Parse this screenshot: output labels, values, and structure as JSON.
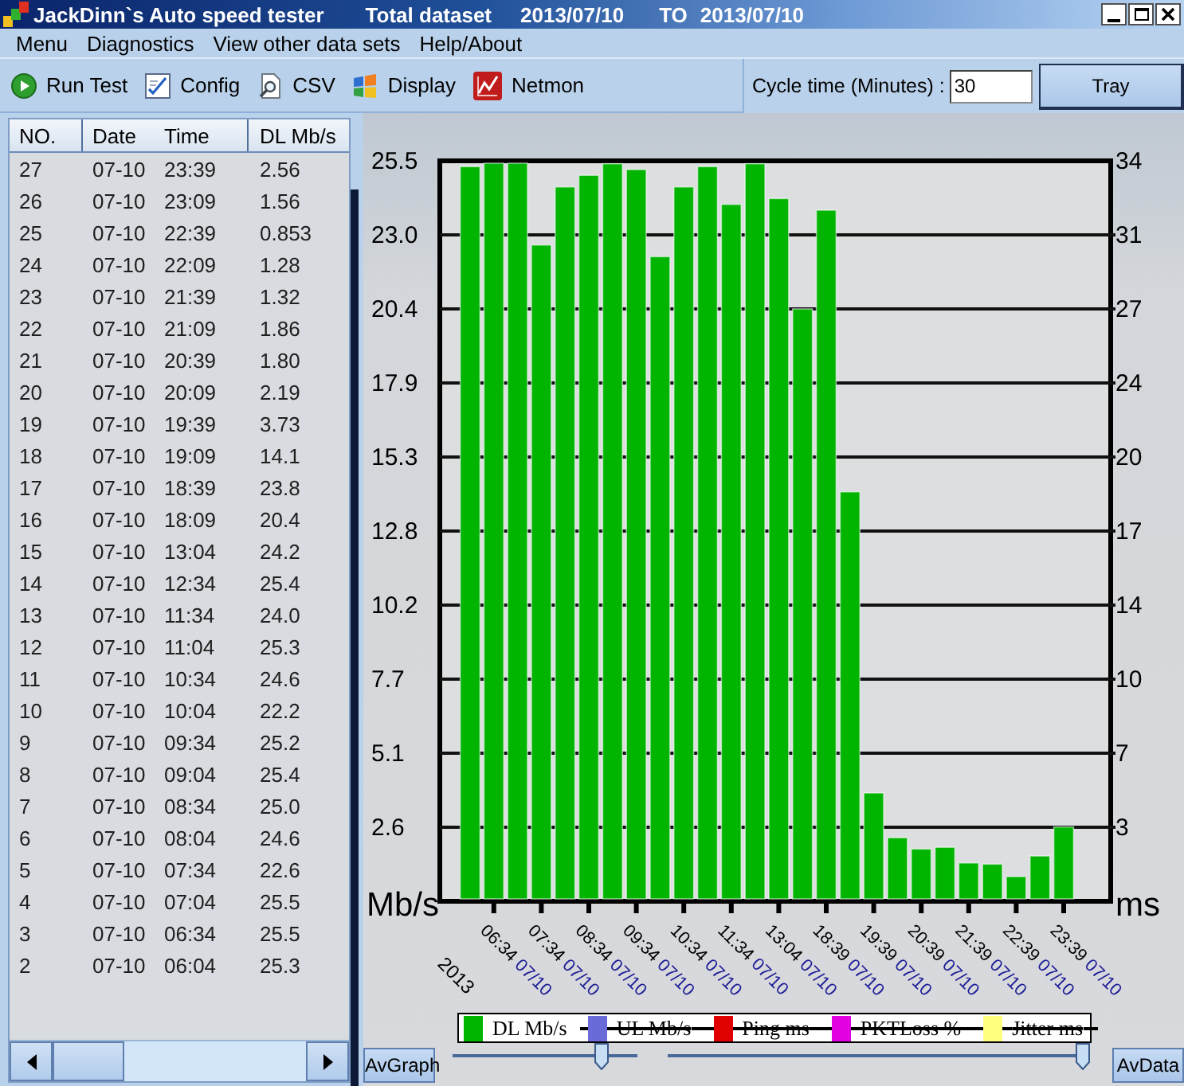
{
  "window": {
    "title": "JackDinn`s Auto speed tester",
    "dataset": "Total dataset",
    "date_from": "2013/07/10",
    "range_separator": "TO",
    "date_to": "2013/07/10"
  },
  "menu": [
    "Menu",
    "Diagnostics",
    "View other data sets",
    "Help/About"
  ],
  "toolbar": [
    "Run Test",
    "Config",
    "CSV",
    "Display",
    "Netmon"
  ],
  "cycle_time": {
    "label": "Cycle time (Minutes) :",
    "value": "30"
  },
  "tray_button": "Tray",
  "table": {
    "columns": [
      "NO.",
      "Date",
      "Time",
      "DL Mb/s"
    ],
    "rows": [
      [
        "27",
        "07-10",
        "23:39",
        "2.56"
      ],
      [
        "26",
        "07-10",
        "23:09",
        "1.56"
      ],
      [
        "25",
        "07-10",
        "22:39",
        "0.853"
      ],
      [
        "24",
        "07-10",
        "22:09",
        "1.28"
      ],
      [
        "23",
        "07-10",
        "21:39",
        "1.32"
      ],
      [
        "22",
        "07-10",
        "21:09",
        "1.86"
      ],
      [
        "21",
        "07-10",
        "20:39",
        "1.80"
      ],
      [
        "20",
        "07-10",
        "20:09",
        "2.19"
      ],
      [
        "19",
        "07-10",
        "19:39",
        "3.73"
      ],
      [
        "18",
        "07-10",
        "19:09",
        "14.1"
      ],
      [
        "17",
        "07-10",
        "18:39",
        "23.8"
      ],
      [
        "16",
        "07-10",
        "18:09",
        "20.4"
      ],
      [
        "15",
        "07-10",
        "13:04",
        "24.2"
      ],
      [
        "14",
        "07-10",
        "12:34",
        "25.4"
      ],
      [
        "13",
        "07-10",
        "11:34",
        "24.0"
      ],
      [
        "12",
        "07-10",
        "11:04",
        "25.3"
      ],
      [
        "11",
        "07-10",
        "10:34",
        "24.6"
      ],
      [
        "10",
        "07-10",
        "10:04",
        "22.2"
      ],
      [
        "9",
        "07-10",
        "09:34",
        "25.2"
      ],
      [
        "8",
        "07-10",
        "09:04",
        "25.4"
      ],
      [
        "7",
        "07-10",
        "08:34",
        "25.0"
      ],
      [
        "6",
        "07-10",
        "08:04",
        "24.6"
      ],
      [
        "5",
        "07-10",
        "07:34",
        "22.6"
      ],
      [
        "4",
        "07-10",
        "07:04",
        "25.5"
      ],
      [
        "3",
        "07-10",
        "06:34",
        "25.5"
      ],
      [
        "2",
        "07-10",
        "06:04",
        "25.3"
      ]
    ]
  },
  "graph": {
    "chart_data": {
      "type": "bar",
      "xlabel": "2013",
      "ylabel": "Mb/s",
      "y2label": "ms",
      "ylim": [
        0,
        25.5
      ],
      "y2lim": [
        0,
        34
      ],
      "grid": true,
      "yticks": [
        {
          "value": 2.55,
          "label": "2.6"
        },
        {
          "value": 5.1,
          "label": "5.1"
        },
        {
          "value": 7.65,
          "label": "7.7"
        },
        {
          "value": 10.2,
          "label": "10.2"
        },
        {
          "value": 12.75,
          "label": "12.8"
        },
        {
          "value": 15.3,
          "label": "15.3"
        },
        {
          "value": 17.85,
          "label": "17.9"
        },
        {
          "value": 20.4,
          "label": "20.4"
        },
        {
          "value": 22.95,
          "label": "23.0"
        },
        {
          "value": 25.5,
          "label": "25.5"
        }
      ],
      "y2ticks": [
        {
          "value": 3.4,
          "label": "3"
        },
        {
          "value": 6.8,
          "label": "7"
        },
        {
          "value": 10.2,
          "label": "10"
        },
        {
          "value": 13.6,
          "label": "14"
        },
        {
          "value": 17,
          "label": "17"
        },
        {
          "value": 20.4,
          "label": "20"
        },
        {
          "value": 23.8,
          "label": "24"
        },
        {
          "value": 27.2,
          "label": "27"
        },
        {
          "value": 30.6,
          "label": "31"
        },
        {
          "value": 34,
          "label": "34"
        }
      ],
      "categories": [
        null,
        "06:34 07/10",
        null,
        "07:34 07/10",
        null,
        "08:34 07/10",
        null,
        "09:34 07/10",
        null,
        "10:34 07/10",
        null,
        "11:34 07/10",
        null,
        "13:04 07/10",
        null,
        "18:39 07/10",
        null,
        "19:39 07/10",
        null,
        "20:39 07/10",
        null,
        "21:39 07/10",
        null,
        "22:39 07/10",
        null,
        "23:39 07/10"
      ],
      "series": [
        {
          "name": "DL Mb/s",
          "color": "#00b400",
          "values": [
            25.3,
            25.5,
            25.5,
            22.6,
            24.6,
            25.0,
            25.4,
            25.2,
            22.2,
            24.6,
            25.3,
            24.0,
            25.4,
            24.2,
            20.4,
            23.8,
            14.1,
            3.73,
            2.19,
            1.8,
            1.86,
            1.32,
            1.28,
            0.85,
            1.56,
            2.56
          ]
        }
      ]
    },
    "legend": [
      {
        "label": "UL Mb/s",
        "color": "#6a6ad8",
        "shown": false
      },
      {
        "label": "Ping ms",
        "color": "#e00000",
        "shown": false
      },
      {
        "label": "PKTLoss %",
        "color": "#e000e0",
        "shown": false
      },
      {
        "label": "Jitter ms",
        "color": "#ffff80",
        "shown": false
      }
    ],
    "buttons": [
      "AvGraph",
      "AvData"
    ],
    "sliders": [
      {
        "level": 0.83
      },
      {
        "level": 1
      }
    ]
  }
}
